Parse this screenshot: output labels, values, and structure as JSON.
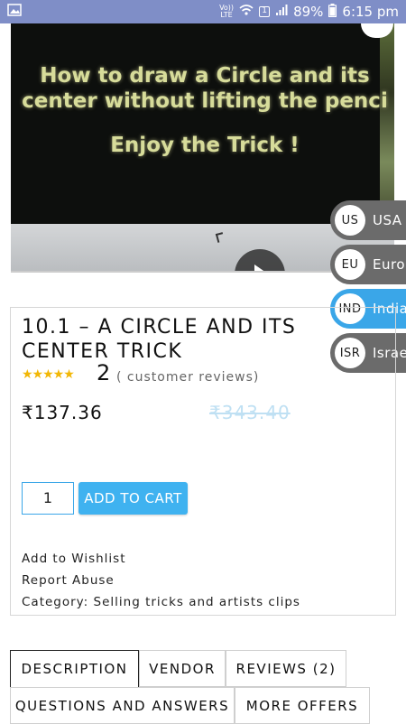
{
  "status_bar": {
    "network_top": "Vo))",
    "network_bottom": "LTE",
    "sim_label": "1",
    "battery": "89%",
    "time": "6:15 pm"
  },
  "video": {
    "title_line1": "How to draw a Circle and its",
    "title_line2": "center without lifting the penci",
    "subtitle": "Enjoy the Trick !"
  },
  "currency_switcher": [
    {
      "code": "US",
      "name": "USA",
      "active": false
    },
    {
      "code": "EU",
      "name": "Euro",
      "active": false
    },
    {
      "code": "IND",
      "name": "India",
      "active": true
    },
    {
      "code": "ISR",
      "name": "Israe",
      "active": false
    }
  ],
  "product": {
    "title": "10.1 – A CIRCLE AND ITS CENTER TRICK",
    "rating_stars": 5,
    "review_count": "2",
    "review_text": "( customer reviews)",
    "price": "₹137.36",
    "old_price": "₹343.40",
    "quantity": "1",
    "add_to_cart_label": "ADD TO CART",
    "wishlist_label": "Add to Wishlist",
    "report_label": "Report Abuse",
    "category_label": "Category: Selling tricks and artists clips"
  },
  "tabs": [
    {
      "label": "DESCRIPTION",
      "active": true
    },
    {
      "label": "VENDOR",
      "active": false
    },
    {
      "label": "REVIEWS (2)",
      "active": false
    },
    {
      "label": "QUESTIONS AND ANSWERS",
      "active": false
    },
    {
      "label": "MORE OFFERS",
      "active": false
    }
  ],
  "colors": {
    "status_bar": "#7f8ec7",
    "accent": "#3aa6e8",
    "star": "#f2b705",
    "currency_inactive": "#6b6b6b"
  }
}
